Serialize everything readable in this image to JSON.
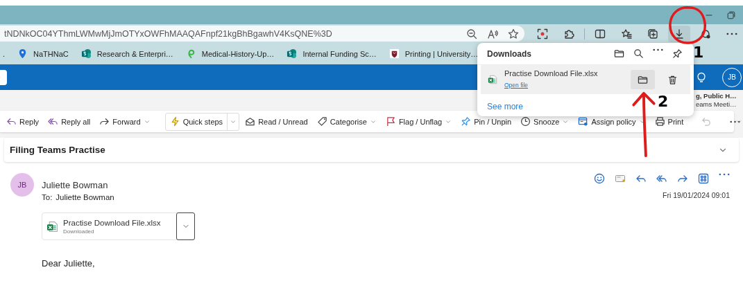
{
  "browser": {
    "url": "tNDNkOC04YThmLWMwMjJmOTYxOWFhMAAQAFnpf21kgBhBgawhV4KsQNE%3D",
    "toolbar": [
      {
        "kind": "screenshot",
        "selected": false
      },
      {
        "kind": "puzzle",
        "selected": false
      },
      {
        "kind": "split",
        "selected": false
      },
      {
        "kind": "favorites",
        "selected": false
      },
      {
        "kind": "collections",
        "selected": false
      },
      {
        "kind": "download",
        "selected": true
      },
      {
        "kind": "profile",
        "selected": false
      },
      {
        "kind": "more",
        "selected": false
      }
    ],
    "bookmarks": [
      {
        "label": ".",
        "kind": "none"
      },
      {
        "label": "NaTHNaC",
        "kind": "pin"
      },
      {
        "label": "Research & Enterpri…",
        "kind": "sharepoint"
      },
      {
        "label": "Medical-History-Up…",
        "kind": "leaf"
      },
      {
        "label": "Internal Funding Sc…",
        "kind": "sharepoint"
      },
      {
        "label": "Printing | University…",
        "kind": "crest"
      }
    ]
  },
  "outlook": {
    "avatar": "JB",
    "peek": [
      {
        "text": "g, Public H…",
        "bold": true
      },
      {
        "text": "eams Meeti…",
        "bold": false
      }
    ],
    "ribbon": [
      {
        "label": "Reply",
        "kind": "reply",
        "split": false,
        "dropdown": false,
        "disabled": false
      },
      {
        "label": "Reply all",
        "kind": "reply-all",
        "split": false,
        "dropdown": false,
        "disabled": false
      },
      {
        "label": "Forward",
        "kind": "forward",
        "split": false,
        "dropdown": true,
        "disabled": false
      },
      {
        "label": "Quick steps",
        "kind": "bolt",
        "split": true,
        "dropdown": true,
        "disabled": false
      },
      {
        "label": "Read / Unread",
        "kind": "envelope",
        "split": false,
        "dropdown": false,
        "disabled": false
      },
      {
        "label": "Categorise",
        "kind": "tag",
        "split": false,
        "dropdown": true,
        "disabled": false
      },
      {
        "label": "Flag / Unflag",
        "kind": "flag",
        "split": false,
        "dropdown": true,
        "disabled": false
      },
      {
        "label": "Pin / Unpin",
        "kind": "pin",
        "split": false,
        "dropdown": false,
        "disabled": false
      },
      {
        "label": "Snooze",
        "kind": "clock",
        "split": false,
        "dropdown": true,
        "disabled": false
      },
      {
        "label": "Assign policy",
        "kind": "policy",
        "split": false,
        "dropdown": true,
        "disabled": false
      },
      {
        "label": "Print",
        "kind": "print",
        "split": false,
        "dropdown": false,
        "disabled": false
      },
      {
        "kind": "undo",
        "split": false,
        "dropdown": false,
        "disabled": true
      },
      {
        "kind": "more",
        "split": false,
        "dropdown": false,
        "disabled": false
      }
    ],
    "subject": "Filing Teams Practise",
    "message": {
      "sender": "Juliette Bowman",
      "avatar": "JB",
      "to_label": "To:",
      "to": "Juliette Bowman",
      "date": "Fri 19/01/2024 09:01",
      "attachment": {
        "name": "Practise Download File.xlsx",
        "status": "Downloaded"
      },
      "body": "Dear Juliette,"
    }
  },
  "downloads": {
    "title": "Downloads",
    "items": [
      {
        "name": "Practise Download File.xlsx",
        "link": "Open file",
        "folder_hover": true
      }
    ],
    "see_more": "See more"
  },
  "annotations": [
    {
      "kind": "circle"
    },
    {
      "kind": "number",
      "text": "1"
    },
    {
      "kind": "arrow"
    },
    {
      "kind": "number",
      "text": "2"
    }
  ]
}
